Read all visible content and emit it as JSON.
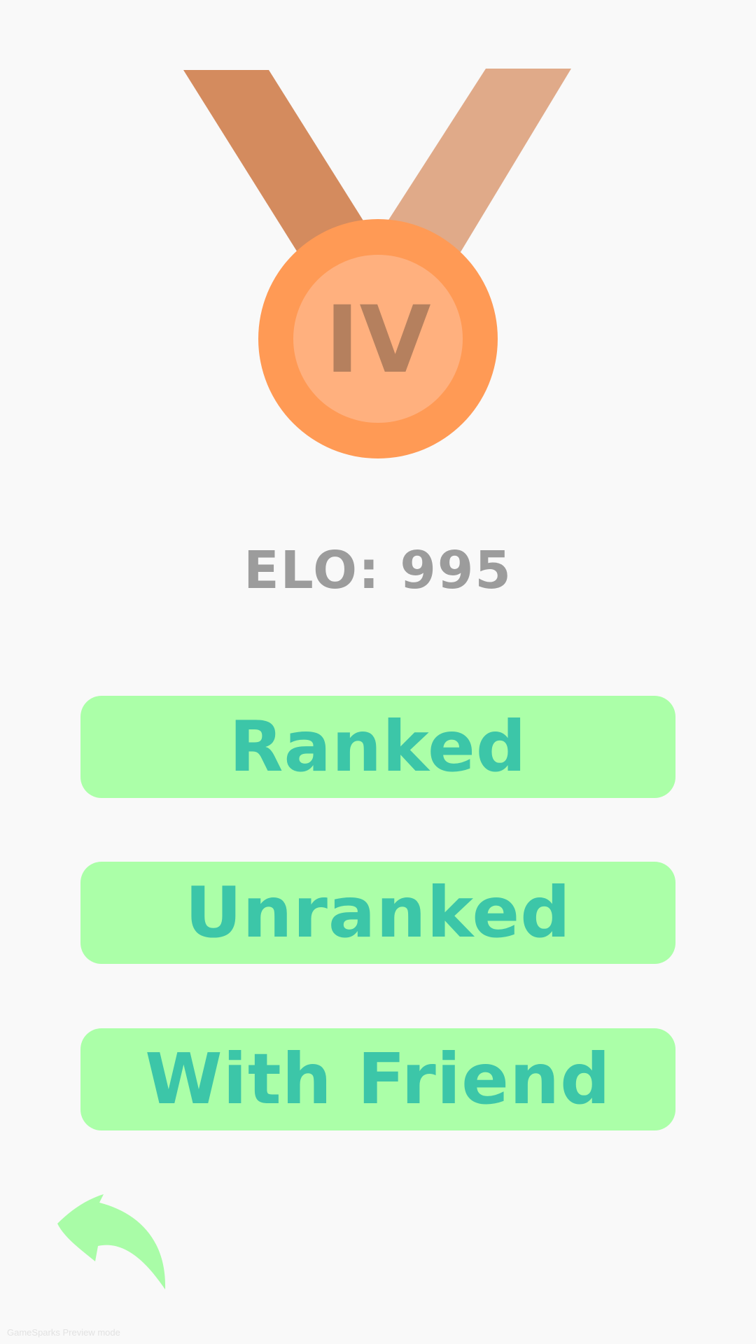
{
  "medal": {
    "rank_numeral": "IV",
    "colors": {
      "ribbon_left": "#d48b5e",
      "ribbon_right": "#e0aa89",
      "outer_ring": "#ff9a55",
      "inner_disc": "#ffb07e",
      "numeral": "#b5805e"
    }
  },
  "elo_text": "ELO: 995",
  "buttons": {
    "ranked": "Ranked",
    "unranked": "Unranked",
    "with_friend": "With Friend"
  },
  "back": {
    "icon": "back-arrow-icon",
    "color": "#a9fca7"
  },
  "watermark": "GameSparks Preview mode",
  "theme": {
    "background": "#f9f9f9",
    "button_bg": "#abffa8",
    "button_text": "#3cc6a8",
    "elo_text": "#9c9c9c"
  }
}
